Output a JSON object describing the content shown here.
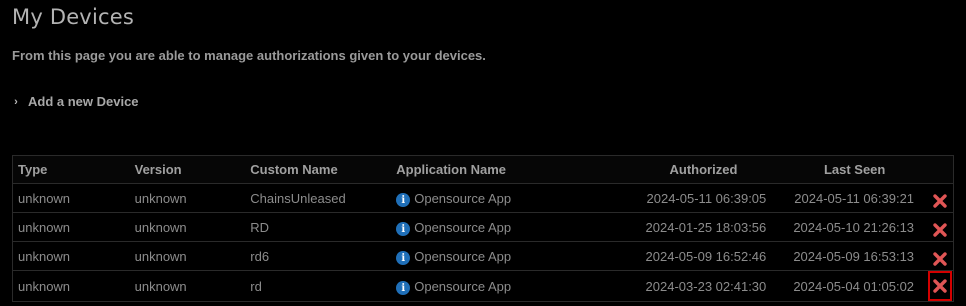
{
  "page": {
    "title": "My Devices",
    "description": "From this page you are able to manage authorizations given to your devices.",
    "add_device_label": "Add a new Device"
  },
  "table": {
    "columns": [
      "Type",
      "Version",
      "Custom Name",
      "Application Name",
      "Authorized",
      "Last Seen"
    ],
    "rows": [
      {
        "type": "unknown",
        "version": "unknown",
        "custom_name": "ChainsUnleased",
        "app_name": "Opensource App",
        "authorized": "2024-05-11 06:39:05",
        "last_seen": "2024-05-11 06:39:21",
        "delete_icon": "red-x-icon"
      },
      {
        "type": "unknown",
        "version": "unknown",
        "custom_name": "RD",
        "app_name": "Opensource App",
        "authorized": "2024-01-25 18:03:56",
        "last_seen": "2024-05-10 21:26:13",
        "delete_icon": "red-x-icon"
      },
      {
        "type": "unknown",
        "version": "unknown",
        "custom_name": "rd6",
        "app_name": "Opensource App",
        "authorized": "2024-05-09 16:52:46",
        "last_seen": "2024-05-09 16:53:13",
        "delete_icon": "red-x-icon"
      },
      {
        "type": "unknown",
        "version": "unknown",
        "custom_name": "rd",
        "app_name": "Opensource App",
        "authorized": "2024-03-23 02:41:30",
        "last_seen": "2024-05-04 01:05:02",
        "delete_icon": "red-x-icon"
      }
    ]
  },
  "colors": {
    "background": "#000000",
    "delete_icon": "#e05555",
    "highlight_border": "#d40000",
    "info_icon": "#1f6fb8"
  }
}
